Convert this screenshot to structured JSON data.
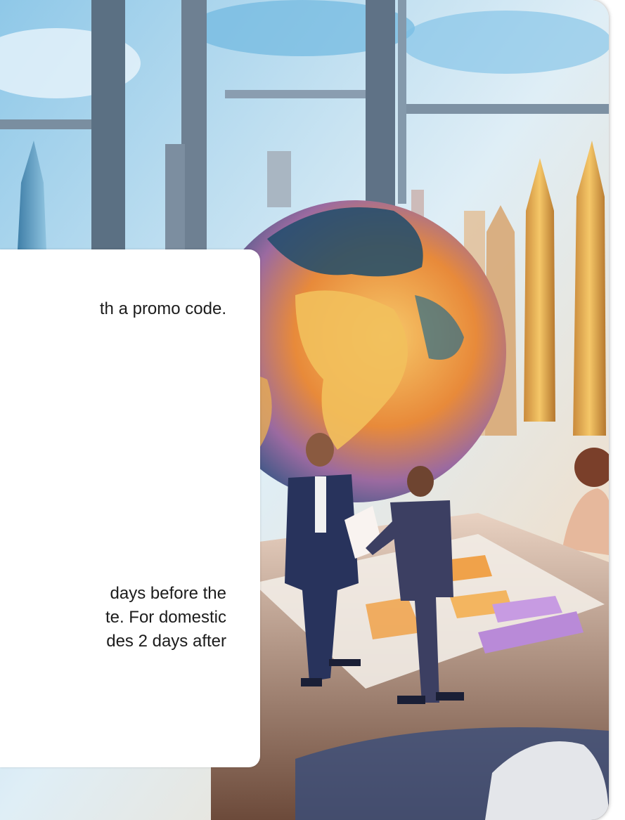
{
  "text_panel": {
    "line_1": "th a promo code.",
    "line_2": "days before the",
    "line_3": "te. For domestic",
    "line_4": "des 2 days after"
  },
  "illustration": {
    "subject": "business-people-globe-city-icon"
  },
  "colors": {
    "sky": "#9fd3ee",
    "sunset": "#f3a33c",
    "suit": "#28335c",
    "panel": "#ffffff",
    "text": "#1c1c1c"
  }
}
